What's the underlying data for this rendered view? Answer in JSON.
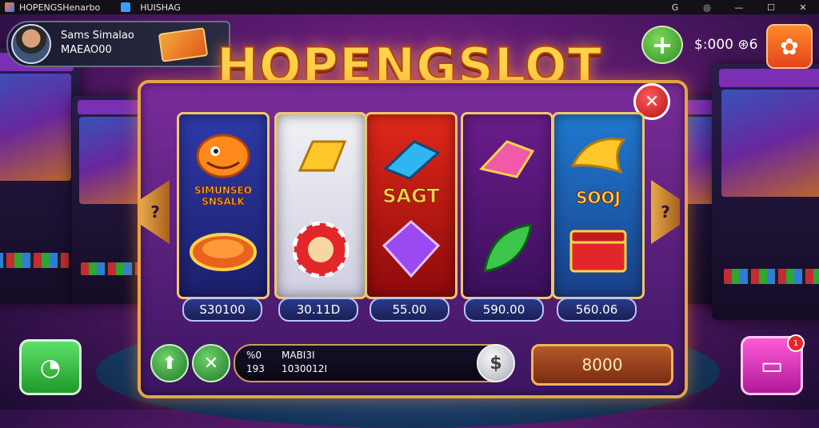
{
  "window": {
    "app_title": "HOPENGSHenarbo",
    "tab_label": "HUISHAG",
    "controls": {
      "pin": "G",
      "target": "◎",
      "minimize": "—",
      "maximize": "☐",
      "close": "✕"
    }
  },
  "profile": {
    "name": "Sams Simalao",
    "subtitle": "MAEAO00"
  },
  "header": {
    "game_title": "HOPENGSLOT",
    "balance": "$:000 ⊛6"
  },
  "reels": [
    {
      "id": "r1",
      "top_symbol": "fish-mascot-icon",
      "label": "SIMUNSEO SNSALK",
      "bottom_symbol": "coin-stack-icon",
      "value": "S30100"
    },
    {
      "id": "r2",
      "top_symbol": "gold-bar-icon",
      "label": "",
      "bottom_symbol": "poker-chip-icon",
      "value": "30.11D"
    },
    {
      "id": "r3",
      "top_symbol": "blue-gem-icon",
      "label": "SAGT",
      "bottom_symbol": "purple-diamond-icon",
      "value": "55.00"
    },
    {
      "id": "r4",
      "top_symbol": "pink-gem-icon",
      "label": "",
      "bottom_symbol": "leaf-icon",
      "value": "590.00"
    },
    {
      "id": "r5",
      "top_symbol": "golden-dragon-icon",
      "label": "SOOJ",
      "bottom_symbol": "treasure-chest-icon",
      "value": "560.06"
    }
  ],
  "nav": {
    "left": "?",
    "right": "?"
  },
  "bet": {
    "l1": "%0",
    "l2": "193",
    "r1": "MABI3I",
    "r2": "1030012I"
  },
  "spin": {
    "value": "8000"
  },
  "badge": {
    "gift_count": "1"
  },
  "colors": {
    "accent": "#ffd24a",
    "frame": "#e8a24a",
    "reel_border": "#f1c56a"
  }
}
